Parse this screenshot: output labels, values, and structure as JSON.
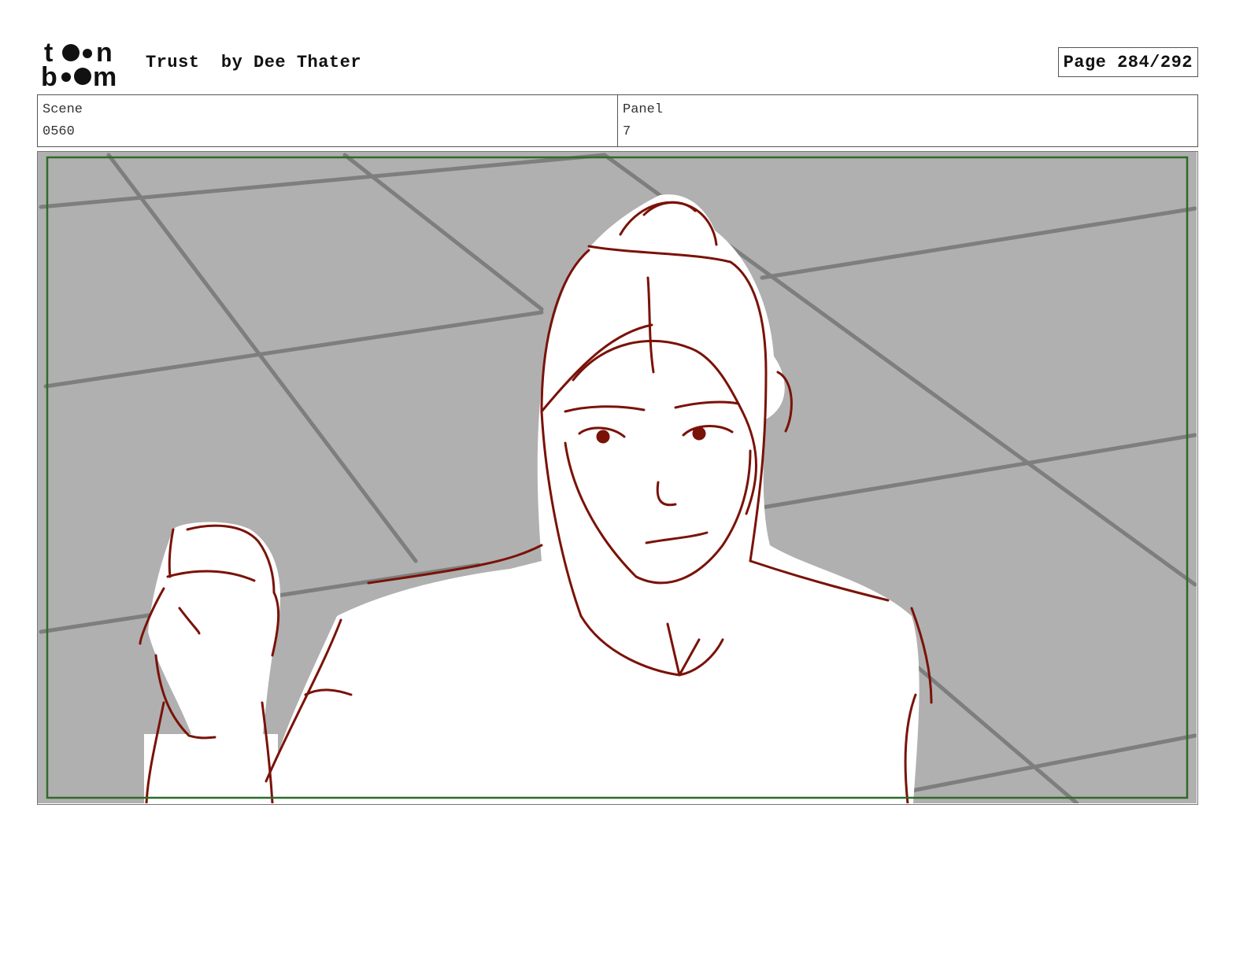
{
  "header": {
    "logo_text": "toon boom",
    "title": "Trust  by Dee Thater",
    "page_label": "Page 284/292"
  },
  "info": {
    "scene_label": "Scene",
    "scene_value": "0560",
    "panel_label": "Panel",
    "panel_value": "7"
  },
  "colors": {
    "sketch_line": "#7a1208",
    "safe_frame": "#2e6b2a",
    "floor": "#b0b0b0",
    "floor_lines": "#7e7e7e"
  },
  "panel_image": {
    "description_icon": "storyboard-sketch-icon"
  }
}
